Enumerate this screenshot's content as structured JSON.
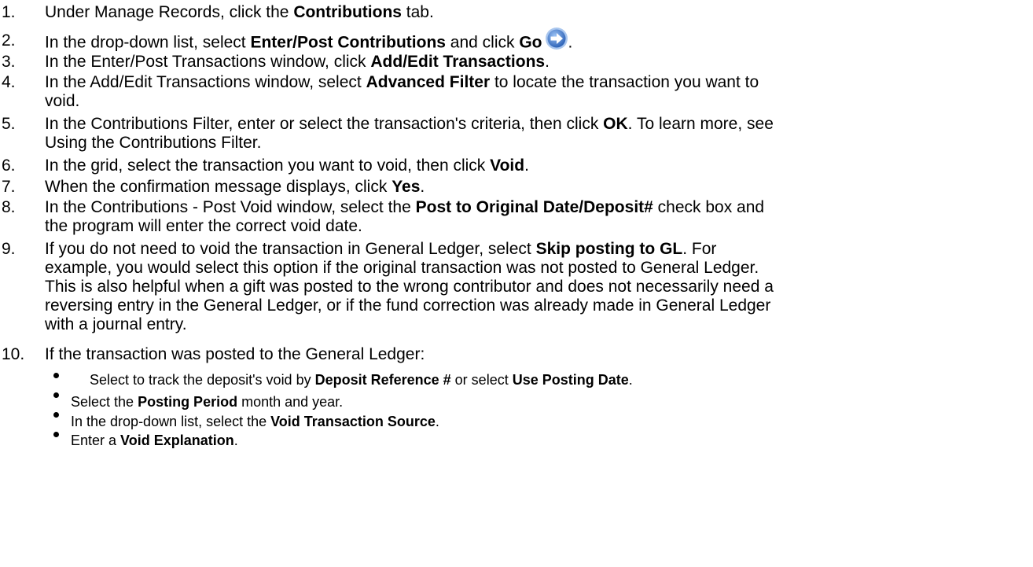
{
  "steps": [
    {
      "num": "1.",
      "parts": [
        "Under Manage Records, click the ",
        "Contributions",
        " tab."
      ]
    },
    {
      "num": "2.",
      "parts": [
        "In the drop-down list, select ",
        "Enter/Post Contributions",
        " and click ",
        "Go",
        "."
      ],
      "icon": "go-arrow-icon"
    },
    {
      "num": "3.",
      "parts": [
        "In the Enter/Post Transactions window, click ",
        "Add/Edit Transactions",
        "."
      ]
    },
    {
      "num": "4.",
      "parts": [
        "In the Add/Edit Transactions window, select ",
        "Advanced Filter",
        " to locate the transaction you want to",
        "void."
      ]
    },
    {
      "num": "5.",
      "parts": [
        "In the Contributions Filter, enter or select the transaction's criteria, then click ",
        "OK",
        ". To learn more, see",
        "Using the Contributions Filter."
      ]
    },
    {
      "num": "6.",
      "parts": [
        "In the grid, select the transaction you want to void, then click ",
        "Void",
        "."
      ]
    },
    {
      "num": "7.",
      "parts": [
        "When the confirmation message displays, click ",
        "Yes",
        "."
      ]
    },
    {
      "num": "8.",
      "parts": [
        "In the Contributions - Post Void window, select the ",
        "Post to Original Date/Deposit#",
        " check box and",
        "the program will enter the correct void date."
      ]
    },
    {
      "num": "9.",
      "parts": [
        "If you do not need to void the transaction in General Ledger, select ",
        "Skip posting to GL",
        ". For",
        "example, you would select this option if the original transaction was not posted to General Ledger.",
        "This is also helpful when a gift was posted to the wrong contributor and does not necessarily need a",
        "reversing entry in the General Ledger, or if the fund correction was already made in General Ledger",
        "with a journal entry."
      ]
    },
    {
      "num": "10.",
      "parts": [
        "If the transaction was posted to the General Ledger:"
      ]
    }
  ],
  "sub_items": [
    {
      "parts": [
        "Select to track the deposit's void by ",
        "Deposit Reference #",
        " or select ",
        "Use Posting Date",
        "."
      ]
    },
    {
      "parts": [
        "Select the ",
        "Posting Period",
        " month and year."
      ]
    },
    {
      "parts": [
        "In the drop-down list, select the ",
        "Void Transaction Source",
        "."
      ]
    },
    {
      "parts": [
        "Enter a ",
        "Void Explanation",
        "."
      ]
    }
  ],
  "colors": {
    "go_icon_fill": "#3a72c8",
    "go_icon_ring": "#a9c6ee"
  }
}
